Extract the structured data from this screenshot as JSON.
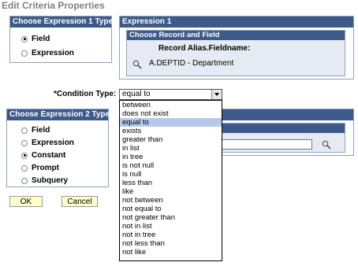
{
  "page_title": "Edit Criteria Properties",
  "expr1_type": {
    "header": "Choose Expression 1 Type",
    "options": [
      {
        "label": "Field",
        "checked": true
      },
      {
        "label": "Expression",
        "checked": false
      }
    ]
  },
  "expression1": {
    "header": "Expression 1",
    "subheader": "Choose Record and Field",
    "field_label": "Record Alias.Fieldname:",
    "field_value": "A.DEPTID - Department"
  },
  "condition": {
    "label": "*Condition Type:",
    "selected": "equal to",
    "options": [
      "between",
      "does not exist",
      "equal to",
      "exists",
      "greater than",
      "in list",
      "in tree",
      "is not null",
      "is null",
      "less than",
      "like",
      "not between",
      "not equal to",
      "not greater than",
      "not in list",
      "not in tree",
      "not less than",
      "not like"
    ]
  },
  "expr2_type": {
    "header": "Choose Expression 2 Type",
    "options": [
      {
        "label": "Field",
        "checked": false
      },
      {
        "label": "Expression",
        "checked": false
      },
      {
        "label": "Constant",
        "checked": true
      },
      {
        "label": "Prompt",
        "checked": false
      },
      {
        "label": "Subquery",
        "checked": false
      }
    ]
  },
  "buttons": {
    "ok": "OK",
    "cancel": "Cancel"
  },
  "colors": {
    "header_bg": "#3d5a8a",
    "selected_item": "#b5c9ea",
    "button_bg": "#ffffcc"
  }
}
